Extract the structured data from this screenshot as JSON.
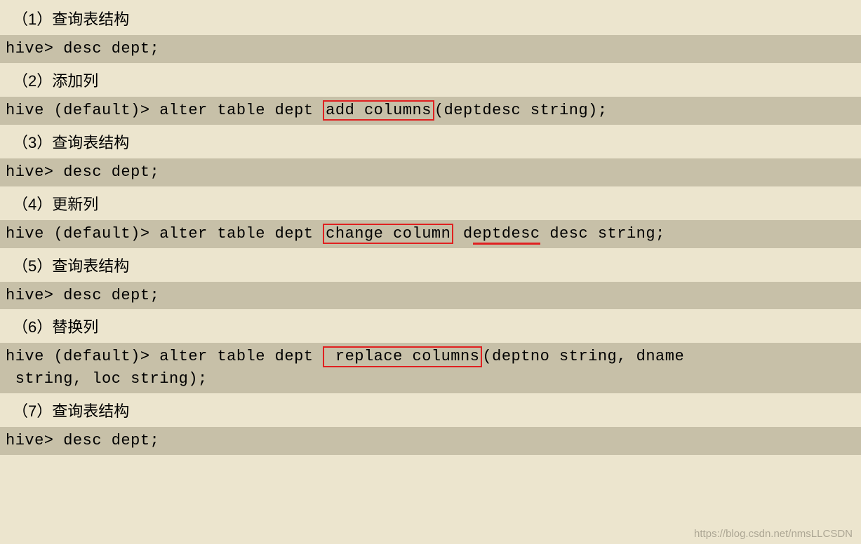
{
  "sections": [
    {
      "title": "（1）查询表结构"
    },
    {
      "title": "（2）添加列"
    },
    {
      "title": "（3）查询表结构"
    },
    {
      "title": "（4）更新列"
    },
    {
      "title": "（5）查询表结构"
    },
    {
      "title": "（6）替换列"
    },
    {
      "title": "（7）查询表结构"
    }
  ],
  "code": {
    "desc_prompt": "hive> desc dept;",
    "alter_prefix": "hive (default)> alter table dept ",
    "add_red": "add columns",
    "add_suffix": "(deptdesc string);",
    "change_red": "change column",
    "change_mid_d": " d",
    "change_underline": "eptdesc",
    "change_suffix": " desc string;",
    "replace_red": " replace columns",
    "replace_suffix": "(deptno string, dname\n string, loc string);"
  },
  "watermark": "https://blog.csdn.net/nmsLLCSDN"
}
